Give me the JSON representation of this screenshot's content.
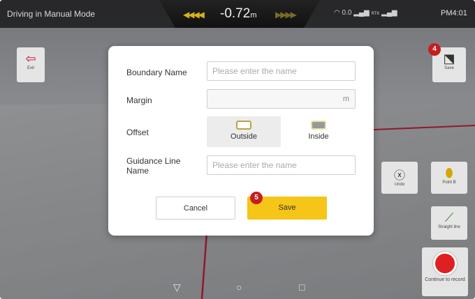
{
  "topbar": {
    "mode_title": "Driving in Manual Mode",
    "deviation": "-0.72",
    "deviation_unit": "m",
    "status": "0.0",
    "rtk": "RTK",
    "time": "PM4:01"
  },
  "left_panel": {
    "exit_label": "Exit"
  },
  "right_panel": {
    "save_label": "Save",
    "undo_label": "Undo",
    "point_b_label": "Point B",
    "straight_line_label": "Straight line",
    "continue_label": "Continue to record"
  },
  "badges": {
    "save_badge": "4",
    "dialog_save_badge": "5"
  },
  "dialog": {
    "boundary_name_label": "Boundary Name",
    "boundary_name_placeholder": "Please enter the name",
    "margin_label": "Margin",
    "margin_unit": "m",
    "offset_label": "Offset",
    "offset_options": [
      {
        "label": "Outside",
        "selected": true
      },
      {
        "label": "Inside",
        "selected": false
      }
    ],
    "guidance_label": "Guidance Line Name",
    "guidance_placeholder": "Please enter the name",
    "cancel_label": "Cancel",
    "save_label": "Save"
  },
  "colors": {
    "accent": "#f5c518",
    "badge": "#c41f1f",
    "record": "#e02020",
    "guide_line": "#c8102e"
  }
}
